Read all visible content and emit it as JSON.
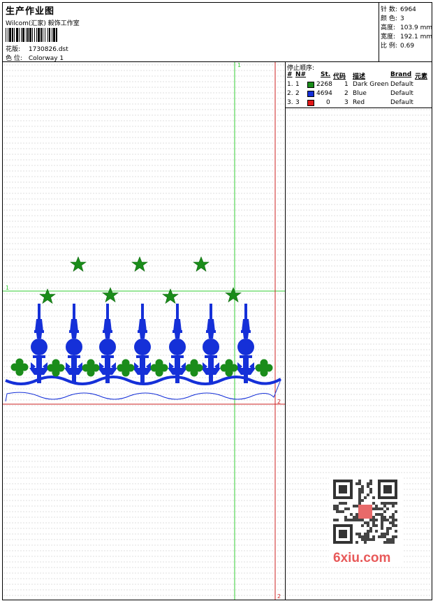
{
  "header": {
    "title": "生产作业图",
    "company": "Wilcom(汇家) 毅饰工作室",
    "pattern_label": "花版:",
    "pattern_value": "1730826.dst",
    "colorway_label": "色 位:",
    "colorway_value": "Colorway 1"
  },
  "stats": {
    "stitches_label": "针 数:",
    "stitches_value": "6964",
    "colors_label": "颜 色:",
    "colors_value": "3",
    "height_label": "高度:",
    "height_value": "103.9 mm",
    "width_label": "宽度:",
    "width_value": "192.1 mm",
    "scale_label": "比 例:",
    "scale_value": "0.69"
  },
  "stop_sequence": {
    "title": "停止顺序:",
    "headers": {
      "num": "#",
      "needle": "N#",
      "stitches": "St.",
      "code": "代码",
      "desc": "描述",
      "brand": "Brand",
      "element": "元素"
    },
    "rows": [
      {
        "num": "1.",
        "needle": "1",
        "stitches": "2268",
        "code": "1",
        "desc": "Dark Green",
        "brand": "Default",
        "color": "#1a8c1a"
      },
      {
        "num": "2.",
        "needle": "2",
        "stitches": "4694",
        "code": "2",
        "desc": "Blue",
        "brand": "Default",
        "color": "#1530d8"
      },
      {
        "num": "3.",
        "needle": "3",
        "stitches": "0",
        "code": "3",
        "desc": "Red",
        "brand": "Default",
        "color": "#e01818"
      }
    ]
  },
  "guides": {
    "green_top": "1",
    "green_left": "1",
    "red_right": "2",
    "red_bottom": "2"
  },
  "watermark": "6xiu.com",
  "colors": {
    "green": "#1a8c1a",
    "blue": "#1530d8",
    "red": "#e01818",
    "guide_green": "#33cc33",
    "guide_red": "#cc2222"
  }
}
